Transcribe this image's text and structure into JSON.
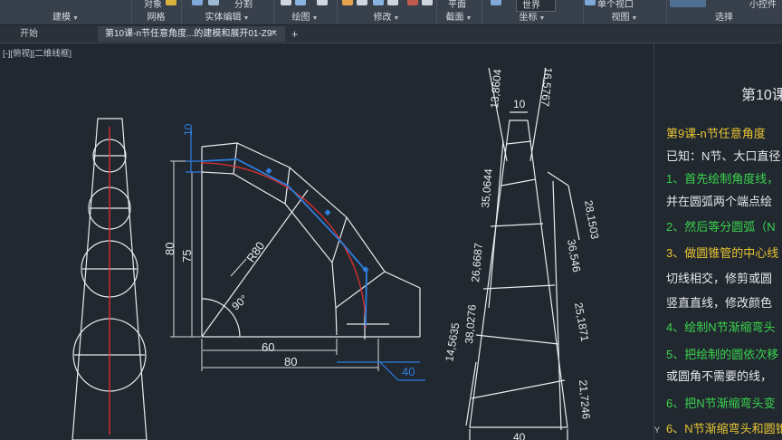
{
  "ribbon": {
    "panels": [
      {
        "title": "建模",
        "has_dropdown": true
      },
      {
        "title": "网格",
        "has_dropdown": false
      },
      {
        "title": "实体编辑",
        "has_dropdown": true
      },
      {
        "title": "绘图",
        "has_dropdown": true
      },
      {
        "title": "修改",
        "has_dropdown": true
      },
      {
        "title": "截面",
        "has_dropdown": true
      },
      {
        "title": "坐标",
        "has_dropdown": true
      },
      {
        "title": "视图",
        "has_dropdown": true
      },
      {
        "title": "选择",
        "has_dropdown": false
      }
    ],
    "partial_labels": {
      "mesh_tool": "对象",
      "solid_tool": "分割",
      "section_tool": "平面",
      "coordinate_select": "世界",
      "viewport_tool": "单个视口",
      "select_tool": "小控件"
    }
  },
  "tabs": [
    {
      "label": "开始",
      "active": false
    },
    {
      "label": "第10课-n节任意角度...的建模和展开01-Z9*",
      "active": true
    }
  ],
  "viewport_label": "[-][俯视][二维线框]",
  "drawing": {
    "left_elbow": {
      "dims": [
        "10",
        "80",
        "75",
        "60",
        "80",
        "40"
      ],
      "radius_label": "R80",
      "angle_label": "90°"
    },
    "right_development": {
      "dims": [
        "10",
        "13,8604",
        "16,5767",
        "35,0644",
        "28,1503",
        "26,6687",
        "36,546",
        "38,0276",
        "25,1871",
        "14,5635",
        "21,7246",
        "40"
      ]
    }
  },
  "notes": {
    "title": "第10课",
    "lines": [
      {
        "text": "第9课-n节任意角度",
        "color": "#e8c532"
      },
      {
        "text": "已知：N节、大口直径",
        "color": "#e6e9ec"
      },
      {
        "text": "1、首先绘制角度线，",
        "color": "#3ad34d"
      },
      {
        "text": "并在圆弧两个端点绘",
        "color": "#e6e9ec"
      },
      {
        "text": "2、然后等分圆弧（N",
        "color": "#3ad34d"
      },
      {
        "text": "3、做圆锥管的中心线",
        "color": "#e8c532"
      },
      {
        "text": "切线相交，修剪或圆",
        "color": "#e6e9ec"
      },
      {
        "text": "竖直直线，修改颜色",
        "color": "#e6e9ec"
      },
      {
        "text": "4、绘制N节渐缩弯头",
        "color": "#3ad34d"
      },
      {
        "text": "5、把绘制的圆依次移",
        "color": "#3ad34d"
      },
      {
        "text": "或圆角不需要的线，",
        "color": "#e6e9ec"
      },
      {
        "text": "6、把N节渐缩弯头变",
        "color": "#3ad34d"
      },
      {
        "text": "6、N节渐缩弯头和圆锥",
        "color": "#e8c532"
      }
    ]
  },
  "ucs_label": "Y"
}
